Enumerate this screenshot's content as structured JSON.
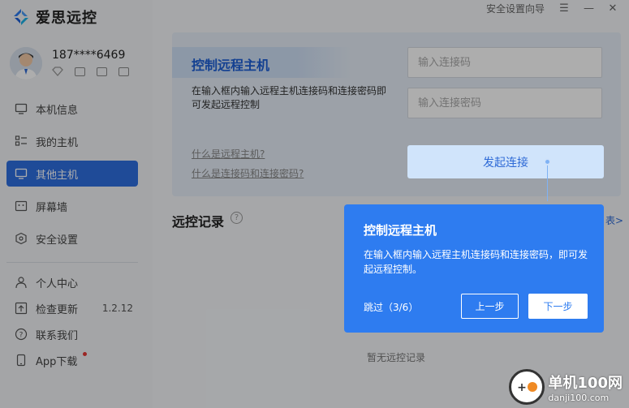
{
  "app": {
    "name": "爱思远控",
    "titlebar": {
      "guide": "安全设置向导",
      "menu": "☰",
      "minimize": "—",
      "close": "✕"
    }
  },
  "user": {
    "phone": "187****6469"
  },
  "nav": [
    {
      "label": "本机信息",
      "icon": "monitor-icon"
    },
    {
      "label": "我的主机",
      "icon": "list-icon"
    },
    {
      "label": "其他主机",
      "icon": "remote-icon",
      "active": true
    },
    {
      "label": "屏幕墙",
      "icon": "screen-wall-icon"
    },
    {
      "label": "安全设置",
      "icon": "shield-icon"
    }
  ],
  "nav2": [
    {
      "label": "个人中心",
      "icon": "person-icon"
    },
    {
      "label": "检查更新",
      "icon": "update-icon",
      "version": "1.2.12"
    },
    {
      "label": "联系我们",
      "icon": "help-icon"
    },
    {
      "label": "App下载",
      "icon": "phone-icon"
    }
  ],
  "card": {
    "title": "控制远程主机",
    "desc": "在输入框内输入远程主机连接码和连接密码即可发起远程控制",
    "link1": "什么是远程主机?",
    "link2": "什么是连接码和连接密码?",
    "code_placeholder": "输入连接码",
    "password_placeholder": "输入连接密码",
    "connect": "发起连接"
  },
  "records": {
    "title": "远控记录",
    "more": "表>",
    "empty": "暂无远控记录"
  },
  "tour": {
    "title": "控制远程主机",
    "desc": "在输入框内输入远程主机连接码和连接密码，即可发起远程控制。",
    "skip": "跳过（3/6）",
    "prev": "上一步",
    "next": "下一步"
  },
  "watermark": {
    "big": "单机100网",
    "small": "danji100.com"
  },
  "colors": {
    "accent": "#2e7cf0",
    "active_nav": "#2f6fe0"
  }
}
